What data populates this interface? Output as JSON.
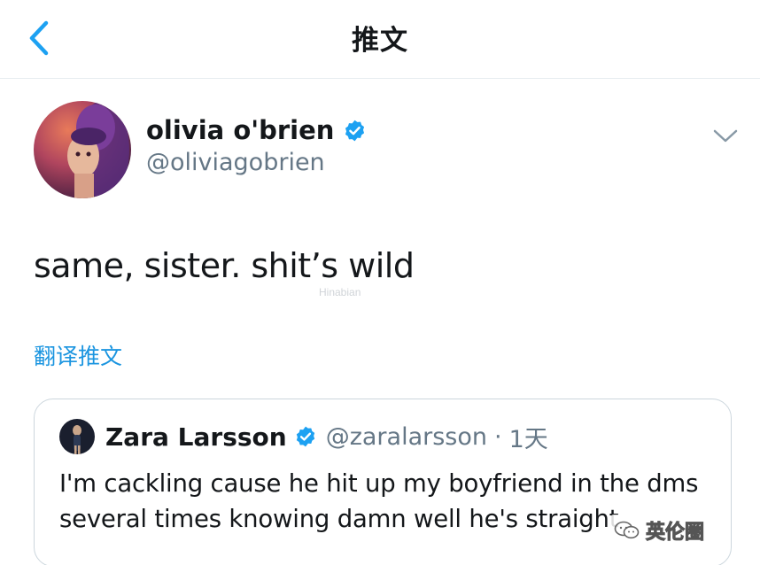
{
  "navbar": {
    "title": "推文",
    "back_icon": "chevron-left-icon"
  },
  "tweet": {
    "display_name": "olivia o'brien",
    "handle": "@oliviagobrien",
    "text": "same, sister. shit’s wild",
    "translate_label": "翻译推文",
    "watermark_text": "Hinabian",
    "colors": {
      "link": "#1b95e0",
      "verified": "#1da1f2",
      "secondary_text": "#657786"
    }
  },
  "quote": {
    "display_name": "Zara Larsson",
    "handle": "@zaralarsson",
    "separator": "·",
    "time": "1天",
    "text": "I'm cackling cause he hit up my boyfriend in the dms several times knowing damn well he's straight"
  },
  "watermark": {
    "label": "英伦圈",
    "icon": "wechat-icon"
  }
}
